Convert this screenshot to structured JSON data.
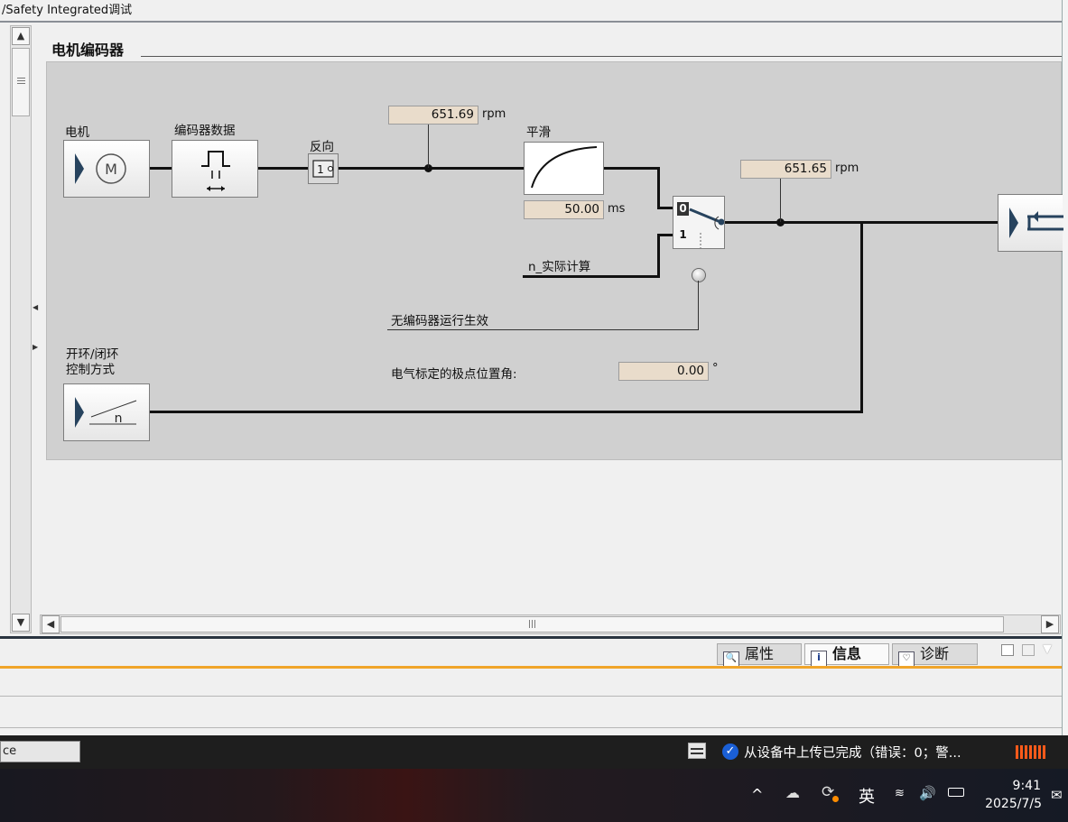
{
  "window": {
    "title": "/Safety Integrated调试"
  },
  "section": {
    "title": "电机编码器"
  },
  "diagram": {
    "motor_label": "电机",
    "encoder_label": "编码器数据",
    "reverse_label": "反向",
    "smoothing_label": "平滑",
    "speed_top": {
      "value": "651.69",
      "unit": "rpm"
    },
    "speed_right": {
      "value": "651.65",
      "unit": "rpm"
    },
    "smoothing_time": {
      "value": "50.00",
      "unit": "ms"
    },
    "switch_0": "0",
    "switch_1": "1",
    "n_actual_label": "n_实际计算",
    "encoderless_label": "无编码器运行生效",
    "control_mode_line1": "开环/闭环",
    "control_mode_line2": "控制方式",
    "pole_angle_label": "电气标定的极点位置角:",
    "pole_angle": {
      "value": "0.00",
      "unit": "°"
    }
  },
  "tabs": [
    {
      "label": "属性",
      "icon": "properties-icon"
    },
    {
      "label": "信息",
      "icon": "info-icon"
    },
    {
      "label": "诊断",
      "icon": "diagnostics-icon"
    }
  ],
  "statusbar": {
    "left_text": "ce",
    "message": "从设备中上传已完成（错误：0；警..."
  },
  "taskbar": {
    "ime": "英",
    "time": "9:41",
    "date": "2025/7/5"
  },
  "colors": {
    "diagram_bg": "#d0d0d0",
    "value_box": "#e9dccb",
    "accent_orange": "#f0a52a",
    "check_blue": "#1a5fd6"
  }
}
